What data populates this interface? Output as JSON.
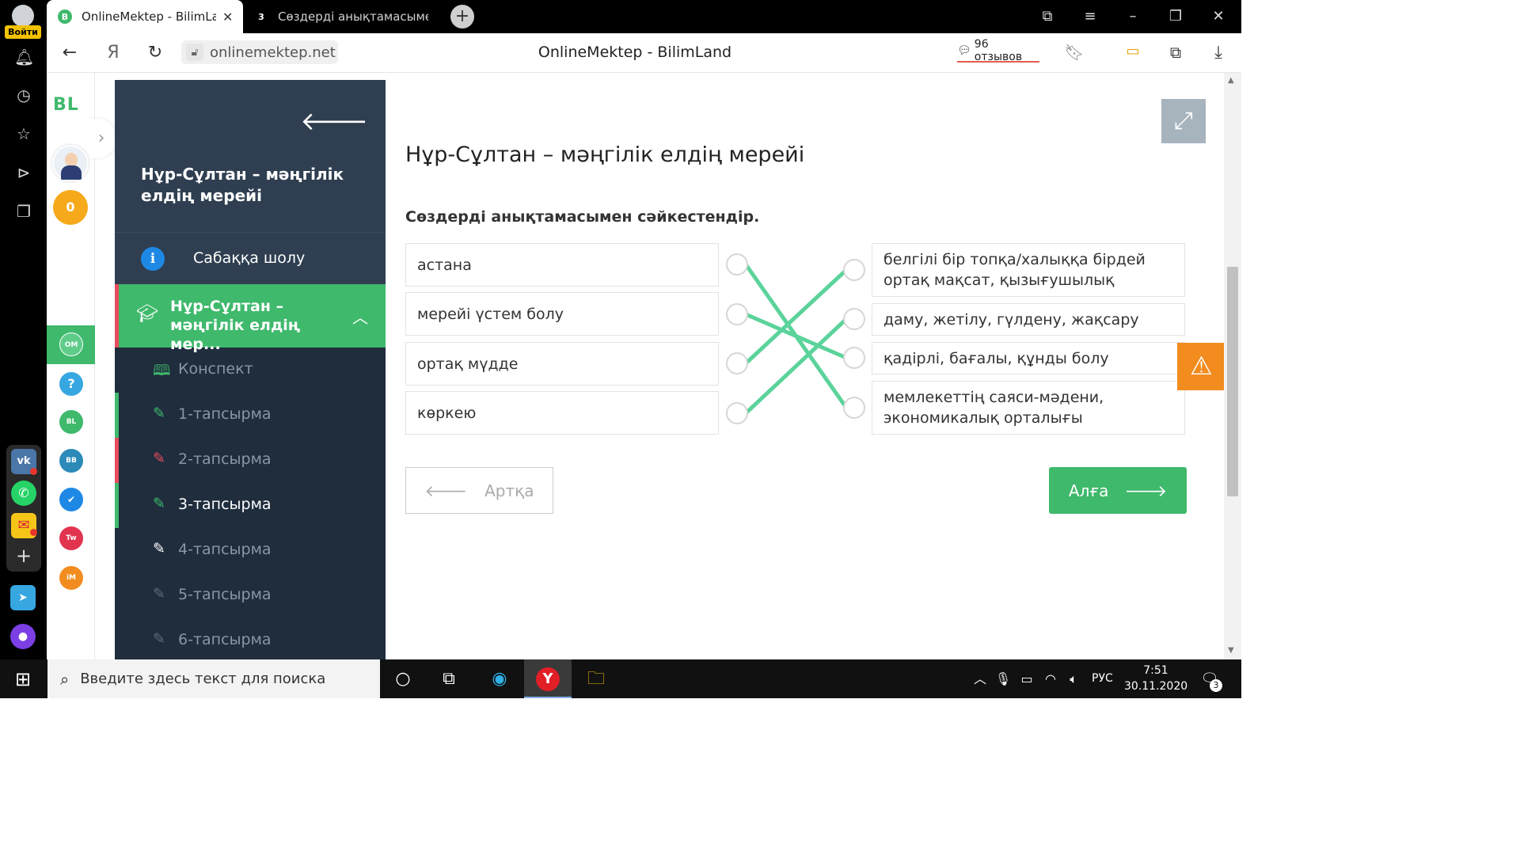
{
  "yandex_sidebar": {
    "login_label": "Войти"
  },
  "tabs": [
    {
      "title": "OnlineMektep - BilimLand",
      "favicon": "B",
      "favicon_color": "#3fb96c",
      "active": true
    },
    {
      "title": "Сөздерді анықтамасымен",
      "favicon": "3",
      "favicon_color": "#000000",
      "active": false
    }
  ],
  "addressbar": {
    "url": "onlinemektep.net",
    "page_title": "OnlineMektep - BilimLand",
    "reviews": "96 отзывов"
  },
  "site_strip": {
    "logo": "BL",
    "score": "0"
  },
  "course": {
    "title": "Нұр-Сұлтан – мәңгілік елдің мерейі",
    "overview_label": "Сабаққа шолу",
    "lesson_label": "Нұр-Сұлтан – мәңгілік елдің мер...",
    "items": [
      {
        "label": "Конспект",
        "icon": "book-icon",
        "color": "#3fb96c"
      },
      {
        "label": "1-тапсырма",
        "icon": "edit-icon",
        "color": "#3fb96c"
      },
      {
        "label": "2-тапсырма",
        "icon": "edit-icon",
        "color": "#e74c5e"
      },
      {
        "label": "3-тапсырма",
        "icon": "edit-icon",
        "color": "#3fb96c"
      },
      {
        "label": "4-тапсырма",
        "icon": "edit-icon",
        "color": "#ffffff"
      },
      {
        "label": "5-тапсырма",
        "icon": "edit-icon",
        "color": "#5d6a78"
      },
      {
        "label": "6-тапсырма",
        "icon": "edit-icon",
        "color": "#5d6a78"
      }
    ]
  },
  "main": {
    "title": "Нұр-Сұлтан – мәңгілік елдің мерейі",
    "instruction": "Сөздерді анықтамасымен сәйкестендір.",
    "left_items": [
      "астана",
      "мерейі үстем болу",
      "ортақ мүдде",
      "көркею"
    ],
    "right_items": [
      "белгілі бір топқа/халыққа бірдей ортақ мақсат, қызығушылық",
      "даму, жетілу, гүлдену, жақсару",
      "қадірлі, бағалы, құнды болу",
      "мемлекеттің саяси-мәдени, экономикалық орталығы"
    ],
    "connections": [
      [
        0,
        3
      ],
      [
        1,
        2
      ],
      [
        2,
        0
      ],
      [
        3,
        1
      ]
    ],
    "line_color": "#5bd39a",
    "back_label": "Артқа",
    "next_label": "Алға"
  },
  "taskbar": {
    "search_placeholder": "Введите здесь текст для поиска",
    "lang": "РУС",
    "time": "7:51",
    "date": "30.11.2020",
    "notifications": "3"
  }
}
